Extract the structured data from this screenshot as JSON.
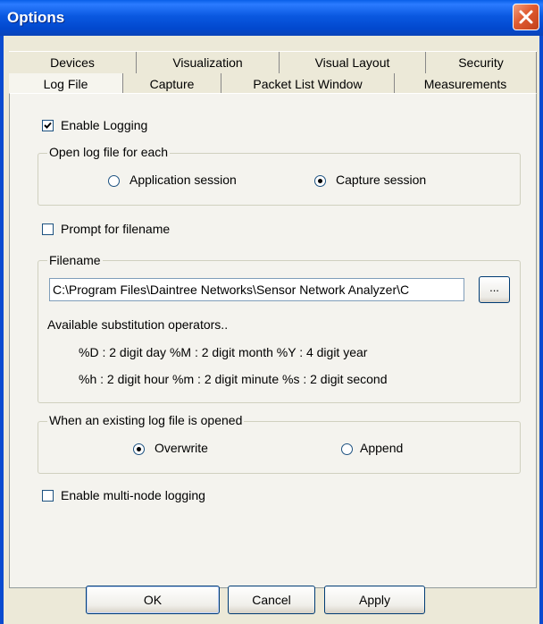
{
  "window": {
    "title": "Options"
  },
  "tabs": {
    "row1": [
      {
        "label": "Devices"
      },
      {
        "label": "Visualization"
      },
      {
        "label": "Visual Layout"
      },
      {
        "label": "Security"
      }
    ],
    "row2": [
      {
        "label": "Log File",
        "selected": true
      },
      {
        "label": "Capture"
      },
      {
        "label": "Packet List Window"
      },
      {
        "label": "Measurements"
      }
    ]
  },
  "log_file": {
    "enable_logging": {
      "label": "Enable Logging",
      "checked": true
    },
    "open_for_each": {
      "legend": "Open log file for each",
      "options": [
        {
          "label": "Application session",
          "selected": false
        },
        {
          "label": "Capture session",
          "selected": true
        }
      ]
    },
    "prompt_filename": {
      "label": "Prompt for filename",
      "checked": false
    },
    "filename": {
      "legend": "Filename",
      "value": "C:\\Program Files\\Daintree Networks\\Sensor Network Analyzer\\C",
      "browse_label": "...",
      "operators_heading": "Available substitution operators..",
      "operators_line1": "%D : 2 digit day  %M : 2 digit month  %Y : 4 digit year",
      "operators_line2": "%h : 2 digit hour  %m : 2 digit minute  %s : 2 digit second"
    },
    "existing_opened": {
      "legend": "When an existing log file is opened",
      "options": [
        {
          "label": "Overwrite",
          "selected": true
        },
        {
          "label": "Append",
          "selected": false
        }
      ]
    },
    "multi_node": {
      "label": "Enable multi-node logging",
      "checked": false
    }
  },
  "buttons": {
    "ok": "OK",
    "cancel": "Cancel",
    "apply": "Apply"
  }
}
